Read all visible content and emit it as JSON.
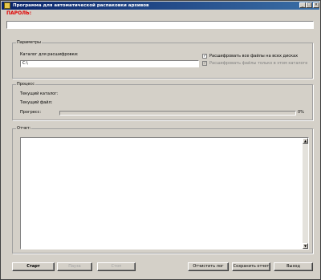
{
  "window": {
    "title": "Программа для автоматической распаковки архивов",
    "controls": {
      "minimize": "_",
      "maximize": "□",
      "close": "×"
    }
  },
  "password": {
    "label": "ПАРОЛЬ:",
    "value": ""
  },
  "params": {
    "group_title": "Параметры",
    "folder_label": "Каталог для расшифровки:",
    "folder_value": "C:\\",
    "check_all_drives": {
      "label": "Расшифровать все файлы на всех дисках",
      "checked": true
    },
    "check_this_folder": {
      "label": "Расшифровать файлы только в этом каталоге",
      "checked": true,
      "disabled": true
    }
  },
  "process": {
    "group_title": "Процесс",
    "current_folder_label": "Текущий каталог:",
    "current_file_label": "Текущий файл:",
    "progress_label": "Прогресс:",
    "progress_value": 0,
    "progress_text": "0%"
  },
  "report": {
    "group_title": "Отчет:",
    "content": ""
  },
  "buttons": {
    "start": "Старт",
    "pause": "Пауза",
    "stop": "Стоп",
    "clear_log": "Отчистить лог",
    "save_report": "Сохранить отчет",
    "exit": "Выход"
  }
}
